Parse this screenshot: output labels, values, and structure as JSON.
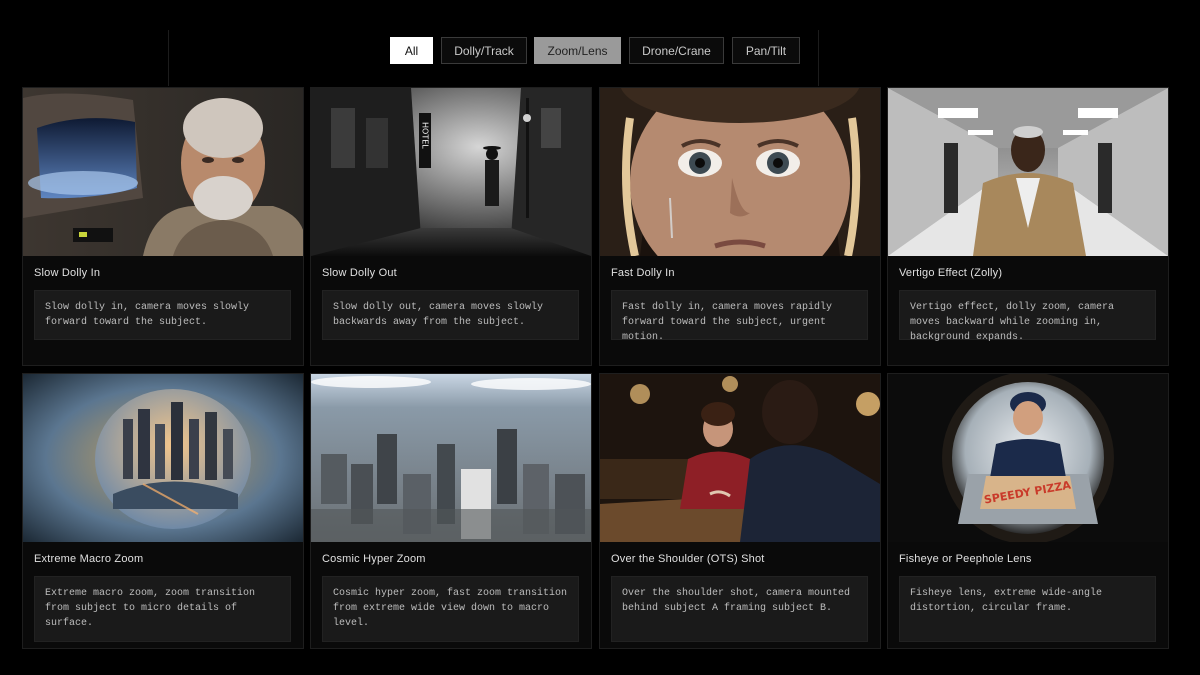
{
  "filters": [
    {
      "label": "All",
      "state": "active"
    },
    {
      "label": "Dolly/Track",
      "state": "default"
    },
    {
      "label": "Zoom/Lens",
      "state": "hover"
    },
    {
      "label": "Drone/Crane",
      "state": "default"
    },
    {
      "label": "Pan/Tilt",
      "state": "default"
    }
  ],
  "cards": [
    {
      "title": "Slow Dolly In",
      "description": "Slow dolly in, camera moves slowly forward toward the subject.",
      "scene": "astronaut"
    },
    {
      "title": "Slow Dolly Out",
      "description": "Slow dolly out, camera moves slowly backwards away from the subject.",
      "scene": "noir-street"
    },
    {
      "title": "Fast Dolly In",
      "description": "Fast dolly in, camera moves rapidly forward toward the subject, urgent motion.",
      "scene": "crying-face"
    },
    {
      "title": "Vertigo Effect (Zolly)",
      "description": "Vertigo effect, dolly zoom, camera moves backward while zooming in, background expands.",
      "scene": "hallway-man"
    },
    {
      "title": "Extreme Macro Zoom",
      "description": "Extreme macro zoom, zoom transition from subject to micro details of surface.",
      "scene": "eye-city"
    },
    {
      "title": "Cosmic Hyper Zoom",
      "description": "Cosmic hyper zoom, fast zoom transition from extreme wide view down to macro level.",
      "scene": "aerial-city"
    },
    {
      "title": "Over the Shoulder (OTS) Shot",
      "description": "Over the shoulder shot, camera mounted behind subject A framing subject B.",
      "scene": "restaurant"
    },
    {
      "title": "Fisheye or Peephole Lens",
      "description": "Fisheye lens, extreme wide-angle distortion, circular frame.",
      "scene": "peephole-pizza"
    }
  ],
  "scene_text": {
    "hotel_sign": "HOTEL",
    "pizza_box": "SPEEDY PIZZA"
  }
}
